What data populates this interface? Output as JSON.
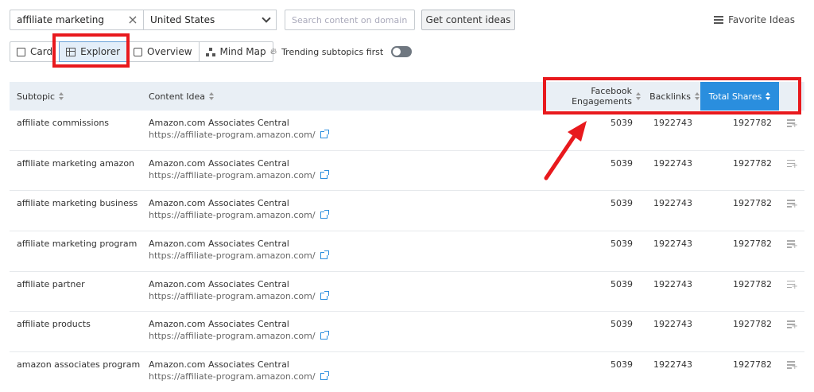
{
  "search": {
    "keyword": "affiliate marketing",
    "country": "United States",
    "domain_placeholder": "Search content on domain",
    "get_ideas_label": "Get content ideas"
  },
  "favorite_ideas_label": "Favorite Ideas",
  "views": [
    {
      "label": "Card",
      "icon": "card-icon"
    },
    {
      "label": "Explorer",
      "icon": "table-icon",
      "active": true
    },
    {
      "label": "Overview",
      "icon": "overview-icon"
    },
    {
      "label": "Mind Map",
      "icon": "mind-map-icon"
    }
  ],
  "trending_label": "Trending subtopics first",
  "columns": {
    "subtopic": "Subtopic",
    "content_idea": "Content Idea",
    "fb_line1": "Facebook",
    "fb_line2": "Engagements",
    "backlinks": "Backlinks",
    "total_shares": "Total Shares"
  },
  "rows": [
    {
      "subtopic": "affiliate commissions",
      "title": "Amazon.com Associates Central",
      "url": "https://affiliate-program.amazon.com/",
      "fb": "5039",
      "backlinks": "1922743",
      "shares": "1927782"
    },
    {
      "subtopic": "affiliate marketing amazon",
      "title": "Amazon.com Associates Central",
      "url": "https://affiliate-program.amazon.com/",
      "fb": "5039",
      "backlinks": "1922743",
      "shares": "1927782"
    },
    {
      "subtopic": "affiliate marketing business",
      "title": "Amazon.com Associates Central",
      "url": "https://affiliate-program.amazon.com/",
      "fb": "5039",
      "backlinks": "1922743",
      "shares": "1927782"
    },
    {
      "subtopic": "affiliate marketing program",
      "title": "Amazon.com Associates Central",
      "url": "https://affiliate-program.amazon.com/",
      "fb": "5039",
      "backlinks": "1922743",
      "shares": "1927782"
    },
    {
      "subtopic": "affiliate partner",
      "title": "Amazon.com Associates Central",
      "url": "https://affiliate-program.amazon.com/",
      "fb": "5039",
      "backlinks": "1922743",
      "shares": "1927782"
    },
    {
      "subtopic": "affiliate products",
      "title": "Amazon.com Associates Central",
      "url": "https://affiliate-program.amazon.com/",
      "fb": "5039",
      "backlinks": "1922743",
      "shares": "1927782"
    },
    {
      "subtopic": "amazon associates program",
      "title": "Amazon.com Associates Central",
      "url": "https://affiliate-program.amazon.com/",
      "fb": "5039",
      "backlinks": "1922743",
      "shares": "1927782"
    }
  ],
  "colors": {
    "accent": "#2a8ede",
    "annotation_red": "#e8191d",
    "header_bg": "#e9eff5"
  }
}
